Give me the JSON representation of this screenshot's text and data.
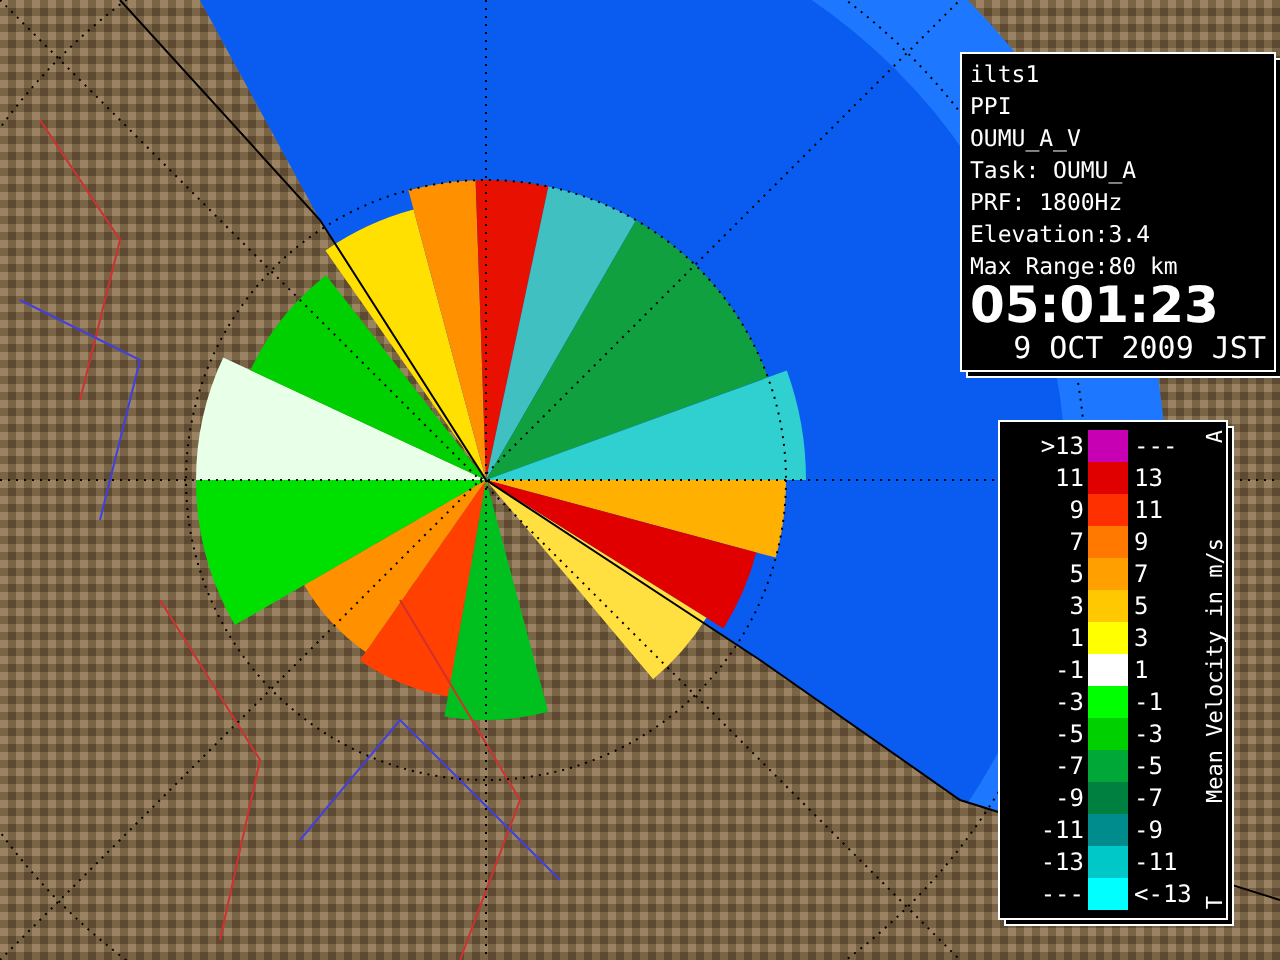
{
  "info_panel": {
    "lines": [
      "ilts1",
      "PPI",
      "OUMU_A_V",
      "Task: OUMU_A",
      "PRF: 1800Hz",
      "Elevation:3.4",
      "Max Range:80 km"
    ],
    "time": "05:01:23",
    "date": "9 OCT 2009 JST"
  },
  "legend": {
    "title": "Mean Velocity in m/s",
    "top_mark": "A",
    "bottom_mark": "T",
    "rows": [
      {
        "low": ">13",
        "high": "---",
        "color": "#c800b4"
      },
      {
        "low": "11",
        "high": "13",
        "color": "#e00000"
      },
      {
        "low": "9",
        "high": "11",
        "color": "#ff3000"
      },
      {
        "low": "7",
        "high": "9",
        "color": "#ff7800"
      },
      {
        "low": "5",
        "high": "7",
        "color": "#ffa000"
      },
      {
        "low": "3",
        "high": "5",
        "color": "#ffc800"
      },
      {
        "low": "1",
        "high": "3",
        "color": "#ffff00"
      },
      {
        "low": "-1",
        "high": "1",
        "color": "#ffffff"
      },
      {
        "low": "-3",
        "high": "-1",
        "color": "#00ff00"
      },
      {
        "low": "-5",
        "high": "-3",
        "color": "#00d000"
      },
      {
        "low": "-7",
        "high": "-5",
        "color": "#00a838"
      },
      {
        "low": "-9",
        "high": "-7",
        "color": "#008040"
      },
      {
        "low": "-11",
        "high": "-9",
        "color": "#008c8c"
      },
      {
        "low": "-13",
        "high": "-11",
        "color": "#00c8c8"
      },
      {
        "low": "---",
        "high": "<-13",
        "color": "#00ffff"
      }
    ]
  }
}
